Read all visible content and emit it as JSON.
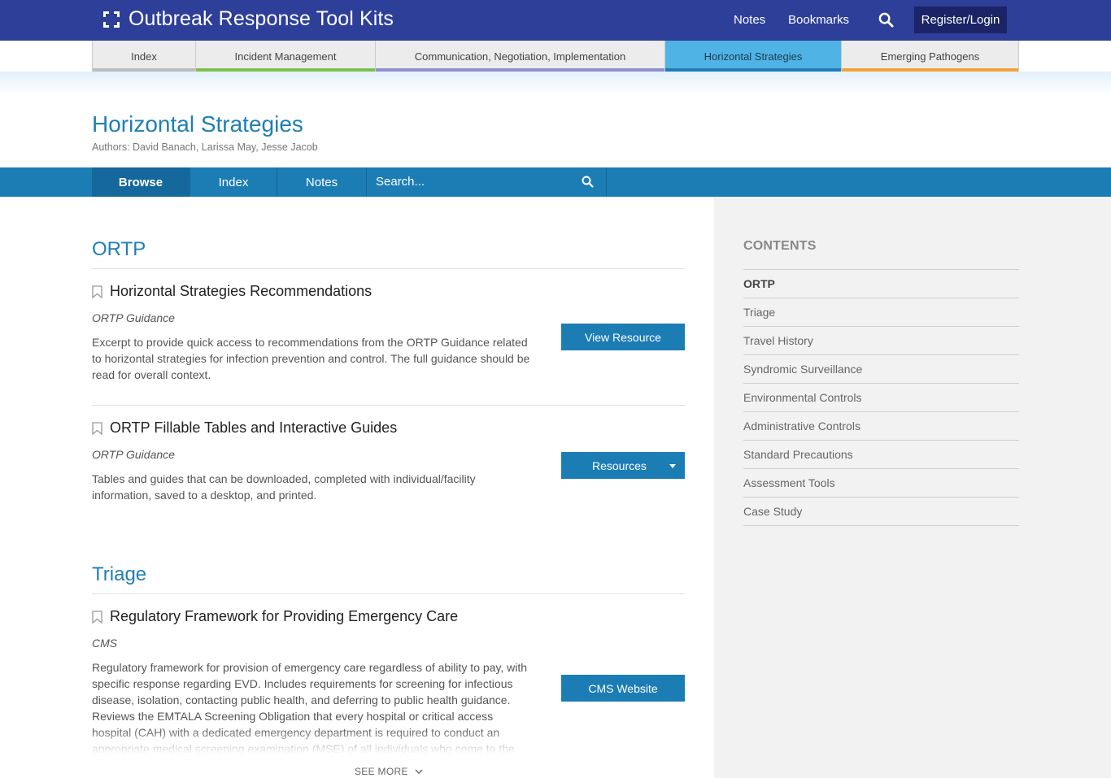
{
  "header": {
    "app_title": "Outbreak Response Tool Kits",
    "notes_label": "Notes",
    "bookmarks_label": "Bookmarks",
    "register_label": "Register/Login"
  },
  "section_tabs": [
    {
      "label": "Index",
      "color": "#bbbbbb"
    },
    {
      "label": "Incident Management",
      "color": "#7cc04a"
    },
    {
      "label": "Communication, Negotiation, Implementation",
      "color": "#8f8fcc"
    },
    {
      "label": "Horizontal Strategies",
      "color": "#1c7db4",
      "active": true
    },
    {
      "label": "Emerging Pathogens",
      "color": "#f5a23a"
    }
  ],
  "page": {
    "title": "Horizontal Strategies",
    "authors": "Authors: David Banach, Larissa May, Jesse Jacob"
  },
  "browse_bar": {
    "browse_label": "Browse",
    "index_label": "Index",
    "notes_label": "Notes",
    "search_placeholder": "Search..."
  },
  "main": {
    "sections": [
      {
        "title": "ORTP",
        "resources": [
          {
            "title": "Horizontal Strategies Recommendations",
            "source": "ORTP Guidance",
            "description": "Excerpt to provide quick access to recommendations from the ORTP Guidance related to horizontal strategies for infection prevention and control. The full guidance should be read for overall context.",
            "button_label": "View Resource"
          },
          {
            "title": "ORTP Fillable Tables and Interactive Guides",
            "source": "ORTP Guidance",
            "description": "Tables and guides that can be downloaded, completed with individual/facility information, saved to a desktop, and printed.",
            "button_label": "Resources"
          }
        ]
      },
      {
        "title": "Triage",
        "resources": [
          {
            "title": "Regulatory Framework for Providing Emergency Care",
            "source": "CMS",
            "description": "Regulatory framework for provision of emergency care regardless of ability to pay, with specific response regarding EVD. Includes requirements for screening for infectious disease, isolation, contacting public health, and deferring to public health guidance. Reviews the EMTALA Screening Obligation that every hospital or critical access hospital (CAH) with a dedicated emergency department is required to conduct an appropriate medical screening examination (MSE) of all individuals who come to the",
            "button_label": "CMS Website"
          }
        ]
      }
    ],
    "see_more_label": "SEE MORE"
  },
  "sidebar": {
    "title": "CONTENTS",
    "items": [
      {
        "label": "ORTP",
        "active": true
      },
      {
        "label": "Triage"
      },
      {
        "label": "Travel History"
      },
      {
        "label": "Syndromic Surveillance"
      },
      {
        "label": "Environmental Controls"
      },
      {
        "label": "Administrative Controls"
      },
      {
        "label": "Standard Precautions"
      },
      {
        "label": "Assessment Tools"
      },
      {
        "label": "Case Study"
      }
    ]
  }
}
